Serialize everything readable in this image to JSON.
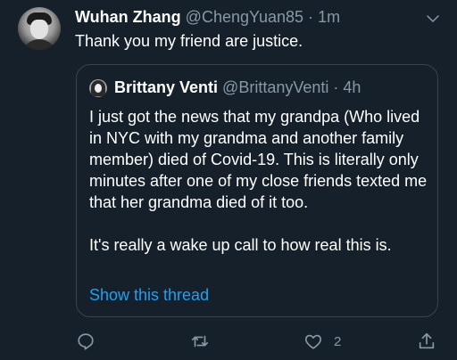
{
  "tweet": {
    "author_name": "Wuhan Zhang",
    "author_handle": "@ChengYuan85",
    "dot": "·",
    "time": "1m",
    "text": "Thank you my friend are justice."
  },
  "quote": {
    "author_name": "Brittany Venti",
    "author_handle": "@BrittanyVenti",
    "dot": "·",
    "time": "4h",
    "paragraph1": "I just got the news that my grandpa (Who lived in NYC with my grandma and another family member) died of Covid-19. This is literally only minutes after one of my close friends texted me that her grandma died of it too.",
    "paragraph2": "It's really a wake up call to how real this is.",
    "show_thread": "Show this thread"
  },
  "actions": {
    "reply_icon": "reply-icon",
    "retweet_icon": "retweet-icon",
    "like_icon": "heart-icon",
    "like_count": "2",
    "share_icon": "share-icon"
  },
  "colors": {
    "background": "#15202b",
    "secondary_text": "#8899a6",
    "link": "#1da1f2",
    "border": "#38444d"
  }
}
